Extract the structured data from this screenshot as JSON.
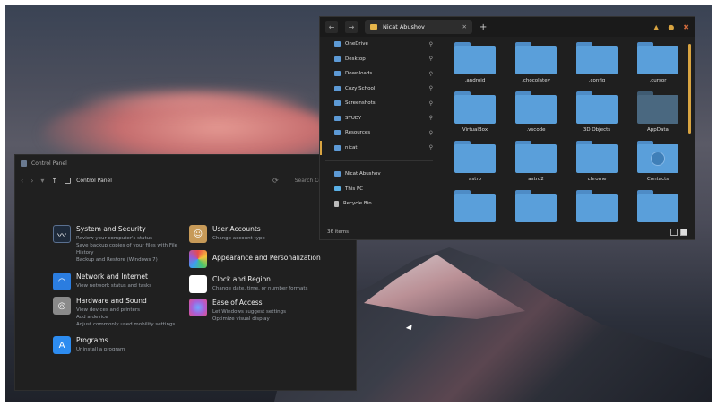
{
  "explorer": {
    "tab_title": "Nicat Abushov",
    "back_icon": "back-arrow-icon",
    "forward_icon": "forward-arrow-icon",
    "add_tab": "+",
    "close_tab": "✕",
    "window_controls": [
      "▲",
      "●",
      "✖"
    ],
    "sidebar": [
      {
        "label": "OneDrive",
        "pinned": true
      },
      {
        "label": "Desktop",
        "pinned": true
      },
      {
        "label": "Downloads",
        "pinned": true
      },
      {
        "label": "Cozy School",
        "pinned": true
      },
      {
        "label": "Screenshots",
        "pinned": true
      },
      {
        "label": "STUDY",
        "pinned": true
      },
      {
        "label": "Resources",
        "pinned": true
      },
      {
        "label": "nicat",
        "pinned": true
      }
    ],
    "sidebar_bottom": [
      {
        "label": "Nicat Abushov"
      },
      {
        "label": "This PC"
      },
      {
        "label": "Recycle Bin"
      }
    ],
    "pin_glyph": "📌",
    "folders": [
      {
        "label": ".android"
      },
      {
        "label": ".chocolatey"
      },
      {
        "label": ".config"
      },
      {
        "label": ".cursor"
      },
      {
        "label": "VirtualBox"
      },
      {
        "label": ".vscode"
      },
      {
        "label": "3D Objects"
      },
      {
        "label": "AppData"
      },
      {
        "label": "astro"
      },
      {
        "label": "astro2"
      },
      {
        "label": "chrome"
      },
      {
        "label": "Contacts"
      },
      {
        "label": ""
      },
      {
        "label": ""
      },
      {
        "label": ""
      },
      {
        "label": ""
      }
    ],
    "status": "36 items"
  },
  "control_panel": {
    "window_title": "Control Panel",
    "breadcrumb": "Control Panel",
    "search_placeholder": "Search Control Panel",
    "nav_arrows": [
      "‹",
      "›",
      "▾",
      "↑"
    ],
    "refresh": "⟳",
    "warn_glyph": "▲",
    "categories_left": [
      {
        "title": "System and Security",
        "links": [
          "Review your computer's status",
          "Save backup copies of your files with File History",
          "Backup and Restore (Windows 7)"
        ],
        "icon": "security-icon"
      },
      {
        "title": "Network and Internet",
        "links": [
          "View network status and tasks"
        ],
        "icon": "network-icon"
      },
      {
        "title": "Hardware and Sound",
        "links": [
          "View devices and printers",
          "Add a device",
          "Adjust commonly used mobility settings"
        ],
        "icon": "hardware-icon"
      },
      {
        "title": "Programs",
        "links": [
          "Uninstall a program"
        ],
        "icon": "programs-icon"
      }
    ],
    "categories_right": [
      {
        "title": "User Accounts",
        "links": [
          "Change account type"
        ],
        "icon": "users-icon"
      },
      {
        "title": "Appearance and Personalization",
        "links": [],
        "icon": "appearance-icon"
      },
      {
        "title": "Clock and Region",
        "links": [
          "Change date, time, or number formats"
        ],
        "icon": "clock-icon"
      },
      {
        "title": "Ease of Access",
        "links": [
          "Let Windows suggest settings",
          "Optimize visual display"
        ],
        "icon": "ease-icon"
      }
    ]
  }
}
